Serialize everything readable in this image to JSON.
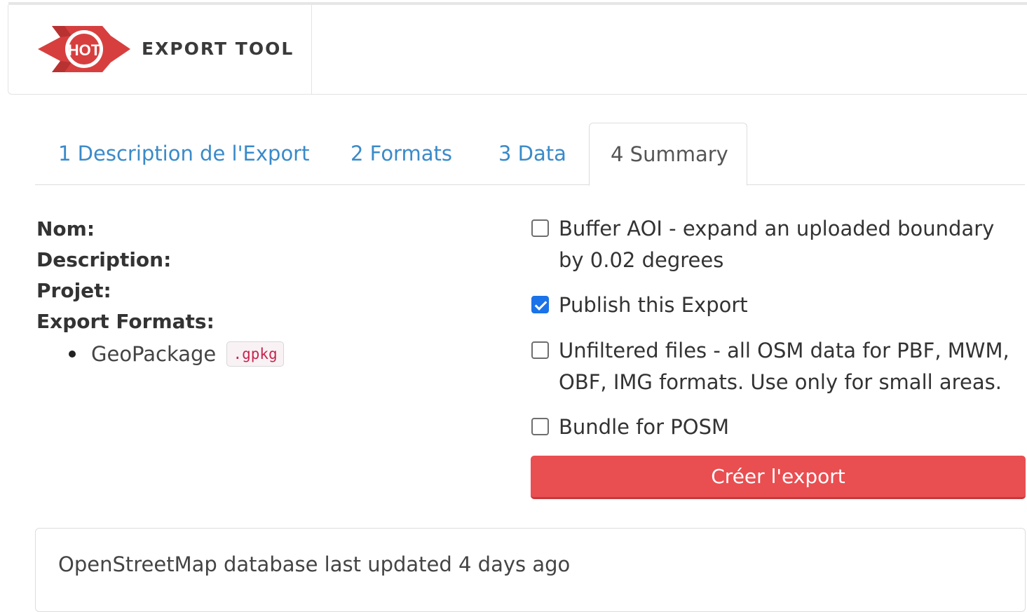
{
  "header": {
    "logo_text": "HOT",
    "brand_name": "EXPORT TOOL"
  },
  "tabs": [
    {
      "label": "1 Description de l'Export",
      "active": false
    },
    {
      "label": "2 Formats",
      "active": false
    },
    {
      "label": "3 Data",
      "active": false
    },
    {
      "label": "4 Summary",
      "active": true
    }
  ],
  "summary": {
    "name_label": "Nom:",
    "description_label": "Description:",
    "project_label": "Projet:",
    "formats_label": "Export Formats:",
    "formats": [
      {
        "name": "GeoPackage",
        "ext": ".gpkg"
      }
    ]
  },
  "options": [
    {
      "line1": "Buffer AOI - expand an uploaded boundary",
      "line2": "by 0.02 degrees",
      "checked": false
    },
    {
      "line1": "Publish this Export",
      "checked": true
    },
    {
      "line1": "Unfiltered files - all OSM data for PBF, MWM,",
      "line2": "OBF, IMG formats. Use only for small areas.",
      "checked": false
    },
    {
      "line1": "Bundle for POSM",
      "checked": false
    }
  ],
  "create_button": "Créer l'export",
  "footer": {
    "status": "OpenStreetMap database last updated 4 days ago"
  },
  "colors": {
    "brand_red": "#d73f3f",
    "link_blue": "#3a8ac9",
    "button_red": "#e94e51",
    "checkbox_blue": "#1a73e8"
  }
}
